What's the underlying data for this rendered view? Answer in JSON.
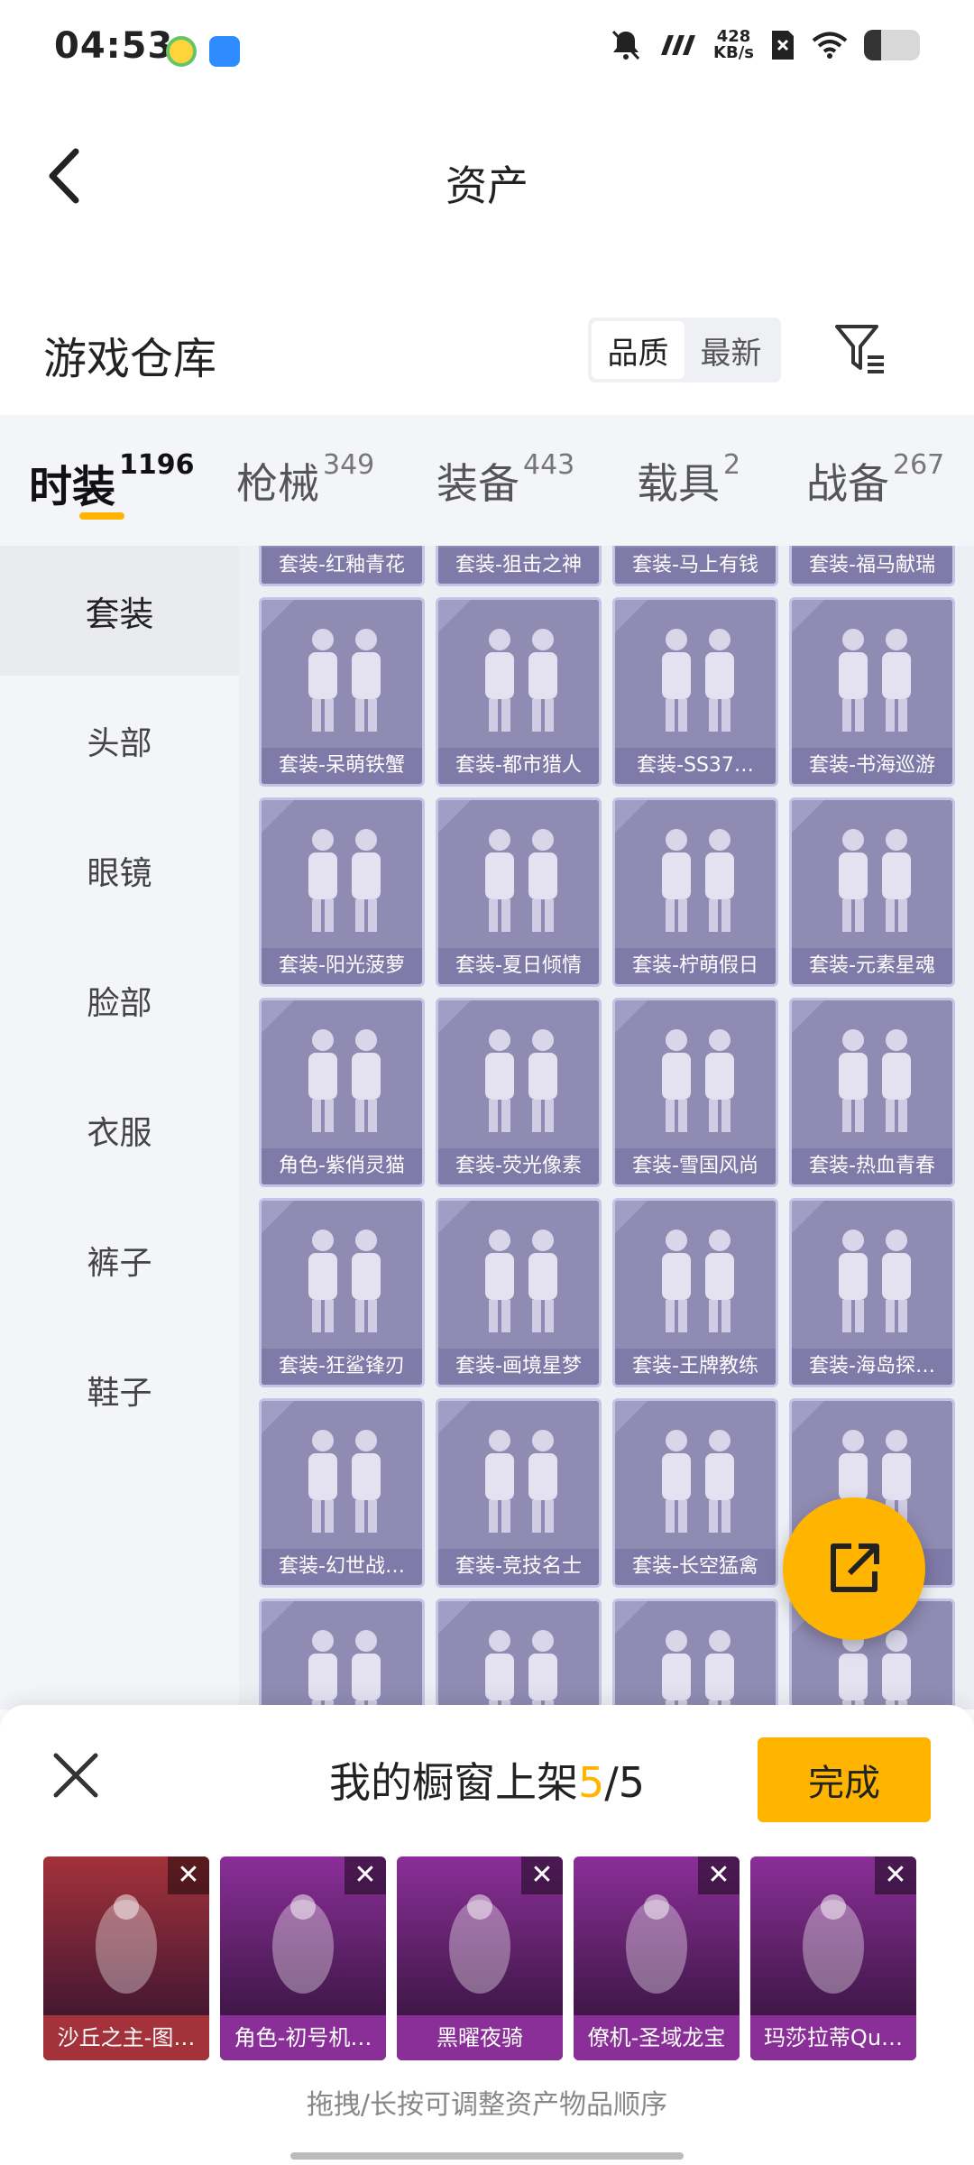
{
  "status_bar": {
    "time": "04:53",
    "speed_value": "428",
    "speed_unit": "KB/s",
    "battery_percent": 30,
    "icons": [
      "notification-off-icon",
      "app-logo-icon",
      "sim-icon",
      "wifi-icon",
      "battery-icon"
    ]
  },
  "header": {
    "title": "资产"
  },
  "warehouse": {
    "title": "游戏仓库",
    "sort_options": [
      "品质",
      "最新"
    ],
    "sort_active": "品质"
  },
  "categories": [
    {
      "label": "时装",
      "count": "1196",
      "active": true
    },
    {
      "label": "枪械",
      "count": "349",
      "active": false
    },
    {
      "label": "装备",
      "count": "443",
      "active": false
    },
    {
      "label": "载具",
      "count": "2",
      "active": false
    },
    {
      "label": "战备",
      "count": "267",
      "active": false
    }
  ],
  "subcategories": [
    {
      "label": "套装",
      "active": true
    },
    {
      "label": "头部",
      "active": false
    },
    {
      "label": "眼镜",
      "active": false
    },
    {
      "label": "脸部",
      "active": false
    },
    {
      "label": "衣服",
      "active": false
    },
    {
      "label": "裤子",
      "active": false
    },
    {
      "label": "鞋子",
      "active": false
    }
  ],
  "items": [
    "套装-红釉青花",
    "套装-狙击之神",
    "套装-马上有钱",
    "套装-福马献瑞",
    "套装-呆萌铁蟹",
    "套装-都市猎人",
    "套装-SS37…",
    "套装-书海巡游",
    "套装-阳光菠萝",
    "套装-夏日倾情",
    "套装-柠萌假日",
    "套装-元素星魂",
    "角色-紫俏灵猫",
    "套装-荧光像素",
    "套装-雪国风尚",
    "套装-热血青春",
    "套装-狂鲨锋刃",
    "套装-画境星梦",
    "套装-王牌教练",
    "套装-海岛探…",
    "套装-幻世战…",
    "套装-竞技名士",
    "套装-长空猛禽",
    "",
    "",
    "",
    "",
    ""
  ],
  "showcase": {
    "title_prefix": "我的橱窗上架",
    "current": "5",
    "separator": "/",
    "total": "5",
    "done_label": "完成",
    "hint": "拖拽/长按可调整资产物品顺序",
    "items": [
      {
        "name": "沙丘之主-图…",
        "color": "#a3323a"
      },
      {
        "name": "角色-初号机…",
        "color": "#8a2f98"
      },
      {
        "name": "黑曜夜骑",
        "color": "#8a2f98"
      },
      {
        "name": "僚机-圣域龙宝",
        "color": "#8a2f98"
      },
      {
        "name": "玛莎拉蒂Qu…",
        "color": "#8a2f98"
      }
    ]
  },
  "colors": {
    "accent": "#ffb400",
    "card": "#8f8bb3",
    "legendary": "#a3323a",
    "epic": "#8a2f98"
  }
}
